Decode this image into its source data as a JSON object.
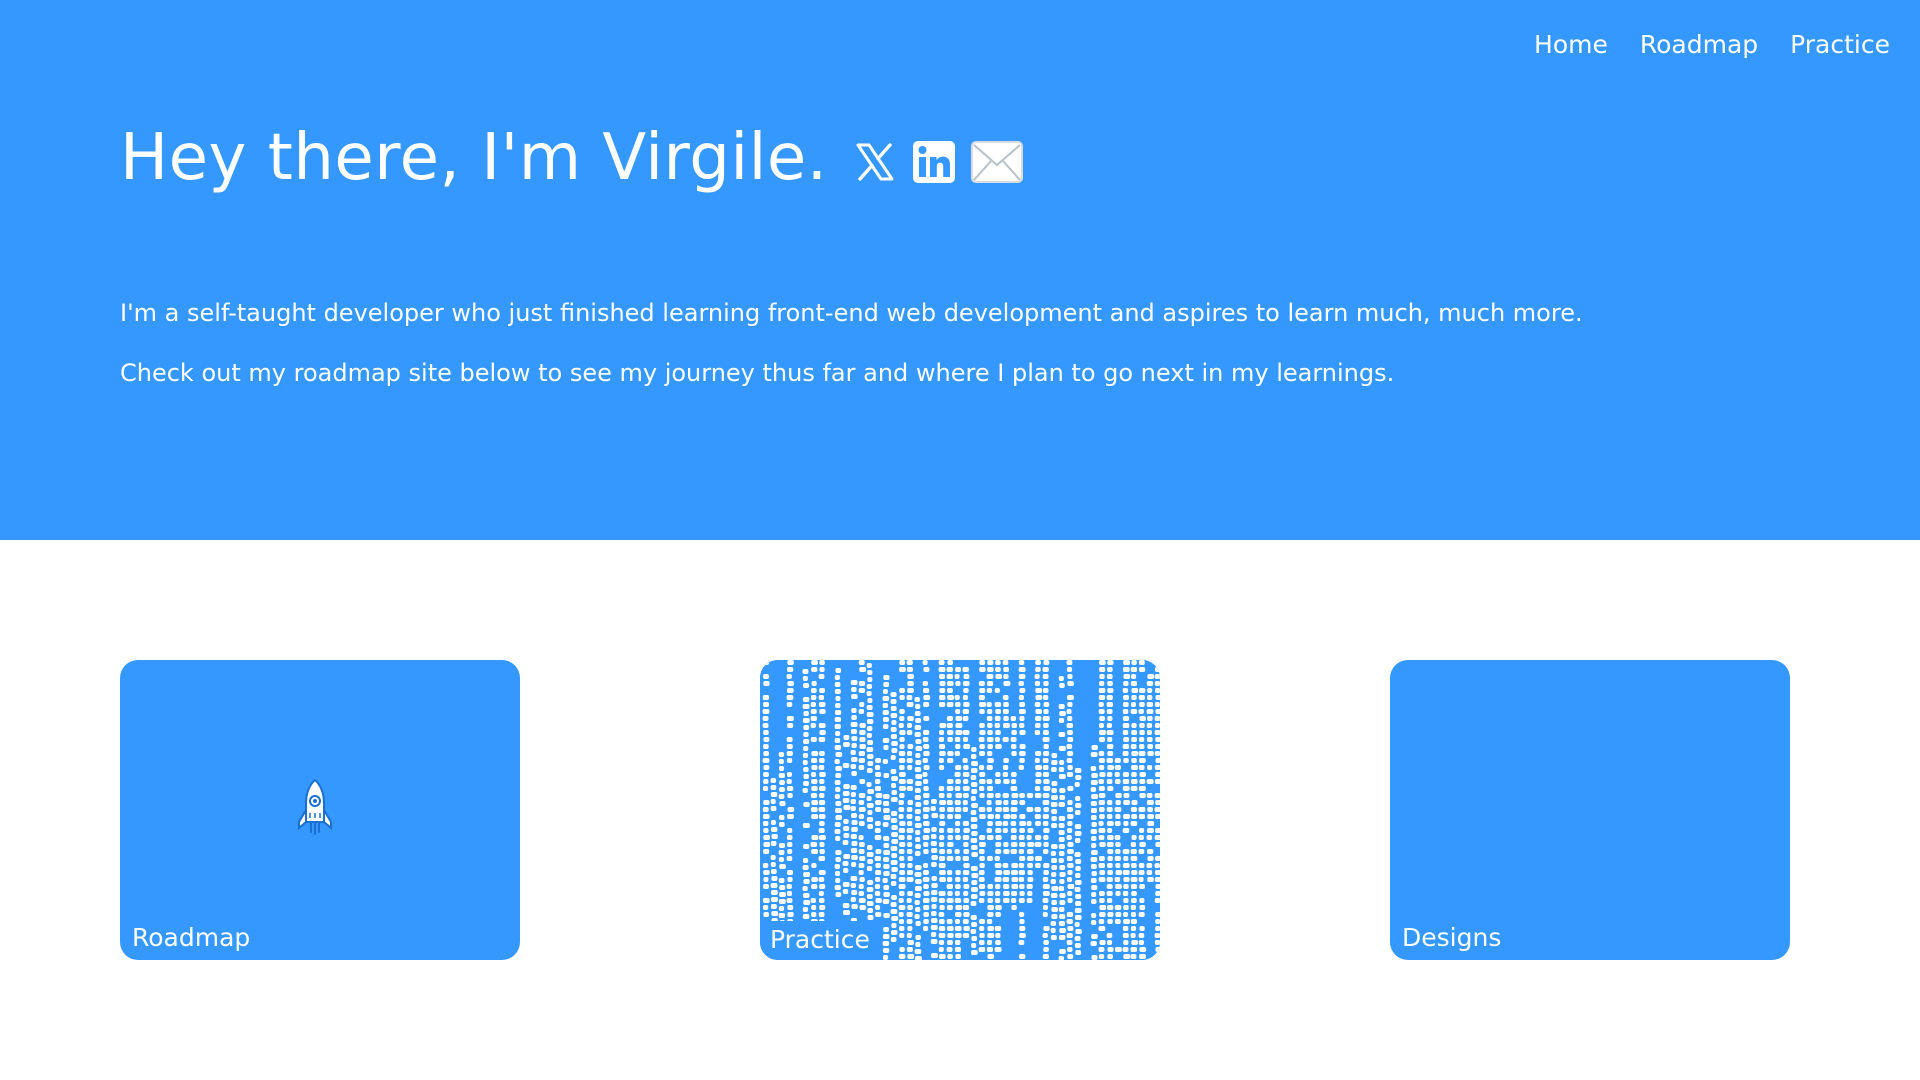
{
  "nav": {
    "items": [
      {
        "label": "Home"
      },
      {
        "label": "Roadmap"
      },
      {
        "label": "Practice"
      }
    ]
  },
  "hero": {
    "headline": "Hey there, I'm Virgile.",
    "socials": [
      {
        "icon": "x-icon"
      },
      {
        "icon": "linkedin-icon"
      },
      {
        "icon": "envelope-icon"
      }
    ],
    "paragraphs": [
      "I'm a self-taught developer who just finished learning front-end web development and aspires to learn much, much more.",
      "Check out my roadmap site below to see my journey thus far and where I plan to go next in my learnings."
    ]
  },
  "cards": [
    {
      "label": "Roadmap",
      "icon": "rocket-icon"
    },
    {
      "label": "Practice",
      "icon": "matrix-code-graphic"
    },
    {
      "label": "Designs"
    }
  ],
  "colors": {
    "primary": "#3498ff",
    "text_on_primary": "#ffffff",
    "page_background": "#ffffff"
  }
}
